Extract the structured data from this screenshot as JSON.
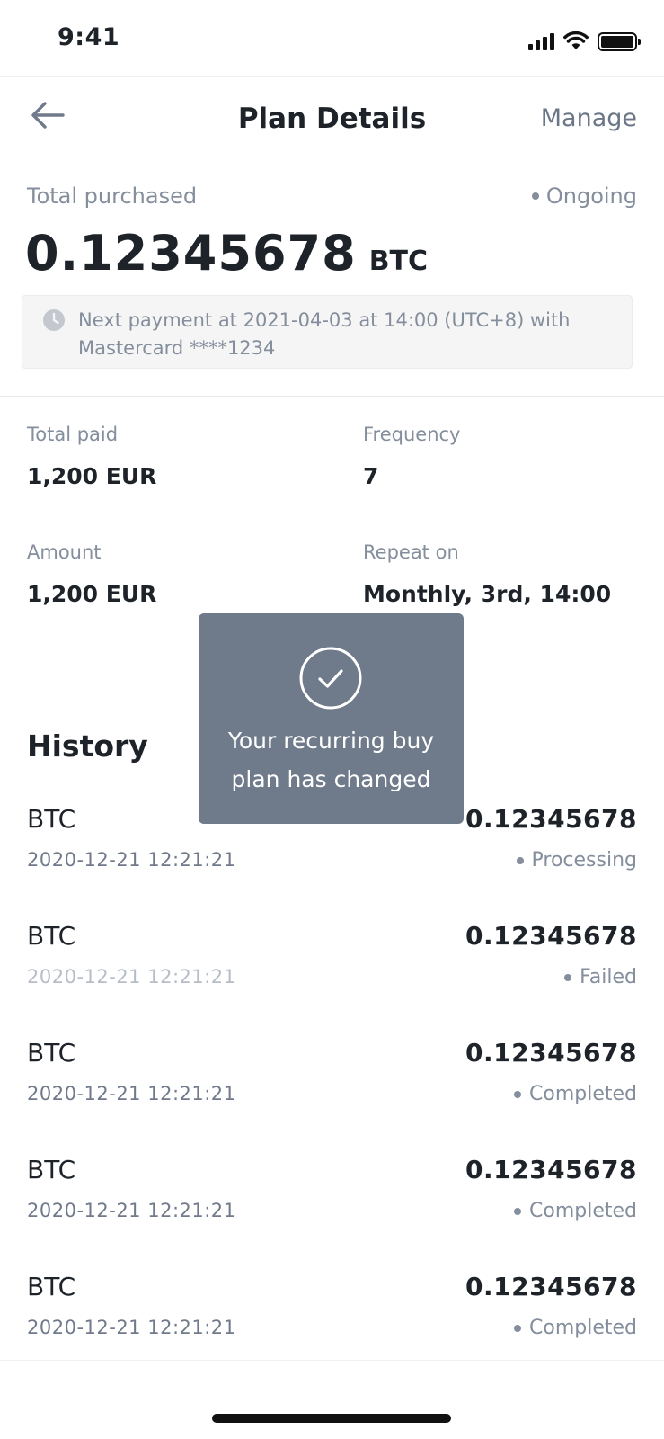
{
  "status_bar": {
    "time": "9:41"
  },
  "nav": {
    "title": "Plan Details",
    "manage_label": "Manage"
  },
  "summary": {
    "total_label": "Total purchased",
    "status": "Ongoing",
    "amount": "0.12345678",
    "unit": "BTC",
    "notice": "Next payment at 2021-04-03 at 14:00 (UTC+8) with Mastercard ****1234"
  },
  "stats": {
    "total_paid_label": "Total paid",
    "total_paid_value": "1,200 EUR",
    "frequency_label": "Frequency",
    "frequency_value": "7",
    "amount_label": "Amount",
    "amount_value": "1,200 EUR",
    "repeat_label": "Repeat on",
    "repeat_value": "Monthly, 3rd, 14:00"
  },
  "history": {
    "title": "History",
    "items": [
      {
        "asset": "BTC",
        "date": "2020-12-21 12:21:21",
        "amount": "0.12345678",
        "status": "Processing"
      },
      {
        "asset": "BTC",
        "date": "2020-12-21 12:21:21",
        "amount": "0.12345678",
        "status": "Failed"
      },
      {
        "asset": "BTC",
        "date": "2020-12-21 12:21:21",
        "amount": "0.12345678",
        "status": "Completed"
      },
      {
        "asset": "BTC",
        "date": "2020-12-21 12:21:21",
        "amount": "0.12345678",
        "status": "Completed"
      },
      {
        "asset": "BTC",
        "date": "2020-12-21 12:21:21",
        "amount": "0.12345678",
        "status": "Completed"
      }
    ]
  },
  "toast": {
    "line1": "Your recurring buy",
    "line2": "plan has changed",
    "icon": "check-circle-icon"
  },
  "colors": {
    "toast_bg": "#6f7a8a",
    "muted_text": "#848e9c",
    "primary_text": "#1e2329"
  }
}
